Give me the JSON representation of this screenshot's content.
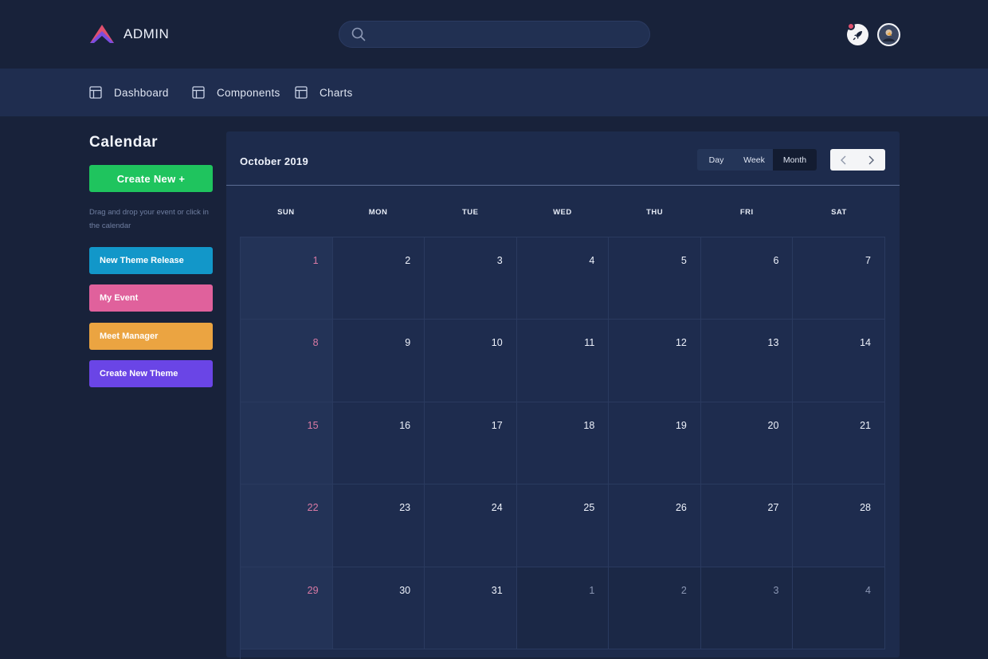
{
  "brand": {
    "name": "ADMIN",
    "logo_icon": "triangle-logo-icon"
  },
  "search": {
    "value": "",
    "placeholder": ""
  },
  "header": {
    "notification_icon": "rocket-icon",
    "avatar_icon": "user-avatar"
  },
  "nav": {
    "items": [
      {
        "label": "Dashboard",
        "icon": "layout-icon"
      },
      {
        "label": "Components",
        "icon": "layout-icon"
      },
      {
        "label": "Charts",
        "icon": "layout-icon"
      }
    ]
  },
  "sidebar": {
    "title": "Calendar",
    "create_label": "Create New +",
    "hint": "Drag and drop your event or click in the calendar",
    "events": [
      {
        "label": "New Theme Release",
        "color": "#1297c9"
      },
      {
        "label": "My Event",
        "color": "#e0619c"
      },
      {
        "label": "Meet Manager",
        "color": "#eba441"
      },
      {
        "label": "Create New Theme",
        "color": "#6a45e6"
      }
    ]
  },
  "calendar": {
    "title": "October 2019",
    "views": [
      "Day",
      "Week",
      "Month"
    ],
    "active_view": "Month",
    "weekdays": [
      "SUN",
      "MON",
      "TUE",
      "WED",
      "THU",
      "FRI",
      "SAT"
    ],
    "days": [
      {
        "d": "1",
        "m": "cur"
      },
      {
        "d": "2",
        "m": "cur"
      },
      {
        "d": "3",
        "m": "cur"
      },
      {
        "d": "4",
        "m": "cur"
      },
      {
        "d": "5",
        "m": "cur"
      },
      {
        "d": "6",
        "m": "cur"
      },
      {
        "d": "7",
        "m": "cur"
      },
      {
        "d": "8",
        "m": "cur"
      },
      {
        "d": "9",
        "m": "cur"
      },
      {
        "d": "10",
        "m": "cur"
      },
      {
        "d": "11",
        "m": "cur"
      },
      {
        "d": "12",
        "m": "cur"
      },
      {
        "d": "13",
        "m": "cur"
      },
      {
        "d": "14",
        "m": "cur"
      },
      {
        "d": "15",
        "m": "cur"
      },
      {
        "d": "16",
        "m": "cur"
      },
      {
        "d": "17",
        "m": "cur"
      },
      {
        "d": "18",
        "m": "cur"
      },
      {
        "d": "19",
        "m": "cur"
      },
      {
        "d": "20",
        "m": "cur"
      },
      {
        "d": "21",
        "m": "cur"
      },
      {
        "d": "22",
        "m": "cur"
      },
      {
        "d": "23",
        "m": "cur"
      },
      {
        "d": "24",
        "m": "cur"
      },
      {
        "d": "25",
        "m": "cur"
      },
      {
        "d": "26",
        "m": "cur"
      },
      {
        "d": "27",
        "m": "cur"
      },
      {
        "d": "28",
        "m": "cur"
      },
      {
        "d": "29",
        "m": "cur"
      },
      {
        "d": "30",
        "m": "cur"
      },
      {
        "d": "31",
        "m": "cur"
      },
      {
        "d": "1",
        "m": "next"
      },
      {
        "d": "2",
        "m": "next"
      },
      {
        "d": "3",
        "m": "next"
      },
      {
        "d": "4",
        "m": "next"
      }
    ]
  },
  "colors": {
    "background": "#18223a",
    "navbar": "#1f2d4f",
    "panel": "#1d2b4c",
    "accent_green": "#1fc45e",
    "sunday_text": "#d97aa5"
  }
}
